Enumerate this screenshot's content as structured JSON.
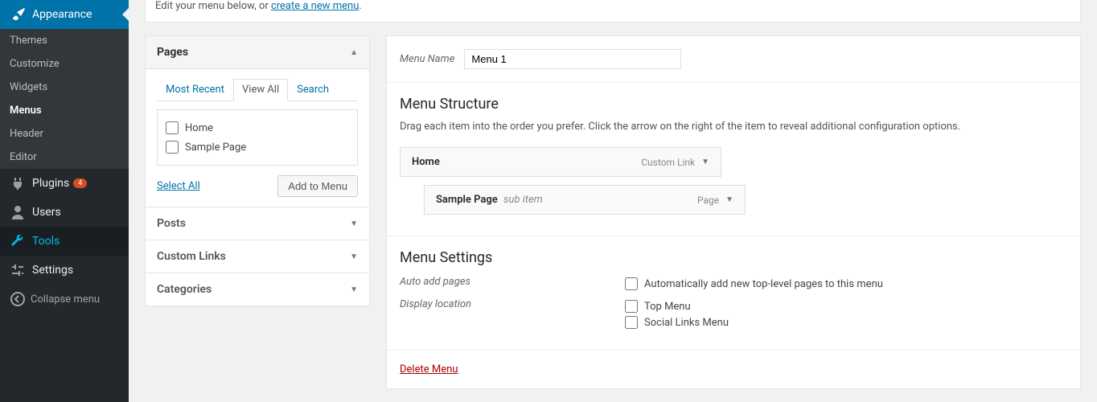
{
  "sidebar": {
    "appearance": {
      "label": "Appearance"
    },
    "submenu": {
      "themes": "Themes",
      "customize": "Customize",
      "widgets": "Widgets",
      "menus": "Menus",
      "header": "Header",
      "editor": "Editor"
    },
    "plugins": {
      "label": "Plugins",
      "badge": "4"
    },
    "users": "Users",
    "tools": "Tools",
    "settings": "Settings",
    "collapse": "Collapse menu"
  },
  "intro": {
    "text": "Edit your menu below, or ",
    "link": "create a new menu",
    "suffix": "."
  },
  "pages_panel": {
    "title": "Pages",
    "tabs": {
      "recent": "Most Recent",
      "view_all": "View All",
      "search": "Search"
    },
    "items": {
      "home": "Home",
      "sample": "Sample Page"
    },
    "select_all": "Select All",
    "add_button": "Add to Menu"
  },
  "accordions": {
    "posts": "Posts",
    "custom_links": "Custom Links",
    "categories": "Categories"
  },
  "menu_name": {
    "label": "Menu Name",
    "value": "Menu 1"
  },
  "structure": {
    "heading": "Menu Structure",
    "description": "Drag each item into the order you prefer. Click the arrow on the right of the item to reveal additional configuration options.",
    "items": {
      "home": {
        "title": "Home",
        "type": "Custom Link"
      },
      "sample": {
        "title": "Sample Page",
        "sub": "sub item",
        "type": "Page"
      }
    }
  },
  "settings": {
    "heading": "Menu Settings",
    "auto_add": {
      "label": "Auto add pages",
      "option": "Automatically add new top-level pages to this menu"
    },
    "display": {
      "label": "Display location",
      "top": "Top Menu",
      "social": "Social Links Menu"
    }
  },
  "delete": {
    "label": "Delete Menu"
  }
}
